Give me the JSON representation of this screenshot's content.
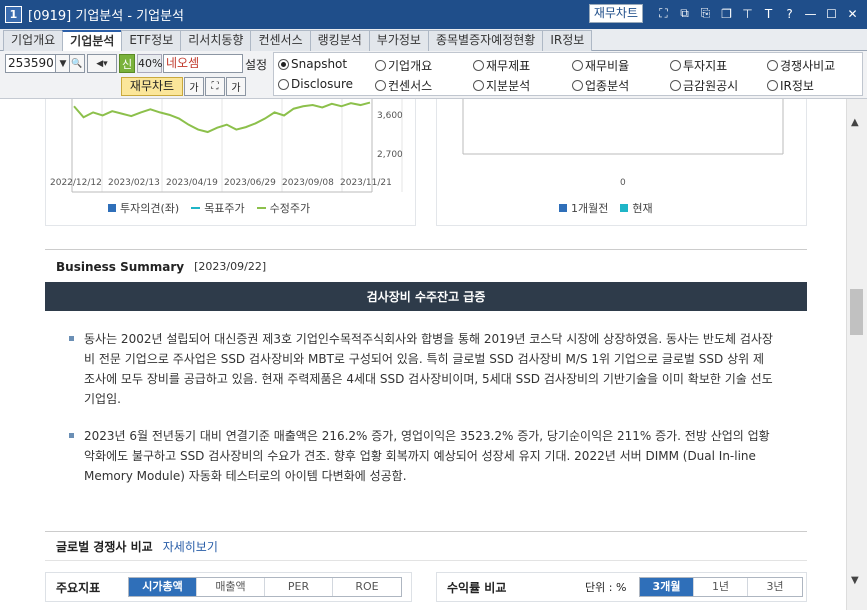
{
  "window": {
    "number": "1",
    "title": "[0919] 기업분석 - 기업분석",
    "fin_chart_label": "재무차트"
  },
  "tabs": [
    "기업개요",
    "기업분석",
    "ETF정보",
    "리서치동향",
    "컨센서스",
    "랭킹분석",
    "부가정보",
    "종목별증자예정현황",
    "IR정보"
  ],
  "toolbar": {
    "code": "253590",
    "shin": "신",
    "percent": "40%",
    "stock_name": "네오셈",
    "setting_label": "설정",
    "fin_chart_label": "재무차트",
    "ga_label": "가",
    "ga2_label": "가"
  },
  "radios": [
    {
      "label": "Snapshot",
      "selected": true
    },
    {
      "label": "기업개요",
      "selected": false
    },
    {
      "label": "재무제표",
      "selected": false
    },
    {
      "label": "재무비율",
      "selected": false
    },
    {
      "label": "투자지표",
      "selected": false
    },
    {
      "label": "경쟁사비교",
      "selected": false
    },
    {
      "label": "Disclosure",
      "selected": false
    },
    {
      "label": "컨센서스",
      "selected": false
    },
    {
      "label": "지분분석",
      "selected": false
    },
    {
      "label": "업종분석",
      "selected": false
    },
    {
      "label": "금감원공시",
      "selected": false
    },
    {
      "label": "IR정보",
      "selected": false
    }
  ],
  "chart_data": [
    {
      "type": "line",
      "x_ticks": [
        "2022/12/12",
        "2023/02/13",
        "2023/04/19",
        "2023/06/29",
        "2023/09/08",
        "2023/11/21"
      ],
      "y_ticks": [
        "3,600",
        "2,700"
      ],
      "series": [
        {
          "name": "투자의견(좌)",
          "color": "#2f6fb9"
        },
        {
          "name": "목표주가",
          "color": "#1fb5c7"
        },
        {
          "name": "수정주가",
          "color": "#8cc04b",
          "values": [
            3800,
            3620,
            3700,
            3650,
            3720,
            3680,
            3640,
            3700,
            3750,
            3700,
            3660,
            3600,
            3500,
            3420,
            3380,
            3450,
            3500,
            3420,
            3460,
            3520,
            3600,
            3700,
            3650,
            3760,
            3800,
            3820,
            3780,
            3840,
            3800,
            3850,
            3820,
            3860
          ]
        }
      ]
    },
    {
      "type": "bar",
      "x_ticks": [
        "0"
      ],
      "series": [
        {
          "name": "1개월전",
          "color": "#2f6fb9"
        },
        {
          "name": "현재",
          "color": "#1fb5c7"
        }
      ]
    }
  ],
  "business_summary": {
    "title": "Business Summary",
    "date": "[2023/09/22]",
    "headline": "검사장비 수주잔고 급증",
    "paragraphs": [
      "동사는 2002년 설립되어 대신증권 제3호 기업인수목적주식회사와 합병을 통해 2019년 코스닥 시장에 상장하였음. 동사는 반도체 검사장비 전문 기업으로 주사업은 SSD 검사장비와 MBT로 구성되어 있음. 특히 글로벌 SSD 검사장비 M/S 1위 기업으로 글로벌 SSD 상위 제조사에 모두 장비를 공급하고 있음. 현재 주력제품은 4세대 SSD 검사장비이며, 5세대 SSD 검사장비의 기반기술을 이미 확보한 기술 선도 기업임.",
      "2023년 6월 전년동기 대비 연결기준 매출액은 216.2% 증가, 영업이익은 3523.2% 증가, 당기순이익은 211% 증가. 전방 산업의 업황 악화에도 불구하고 SSD 검사장비의 수요가 견조. 향후 업황 회복까지 예상되어 성장세 유지 기대. 2022년 서버 DIMM (Dual In-line Memory Module) 자동화 테스터로의 아이템 다변화에 성공함."
    ]
  },
  "global_comp": {
    "title": "글로벌 경쟁사 비교",
    "link": "자세히보기"
  },
  "key_indicators": {
    "title": "주요지표",
    "tabs": [
      "시가총액",
      "매출액",
      "PER",
      "ROE"
    ],
    "active": 0
  },
  "return_compare": {
    "title": "수익률 비교",
    "unit": "단위 : %",
    "tabs": [
      "3개월",
      "1년",
      "3년"
    ],
    "active": 0
  }
}
